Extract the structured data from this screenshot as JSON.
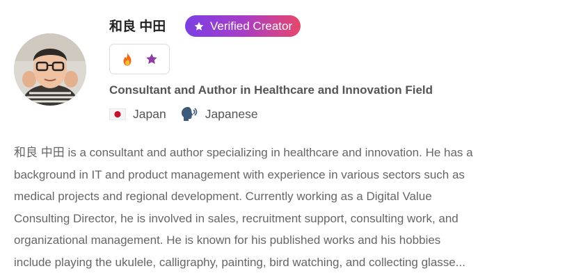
{
  "profile": {
    "name": "和良 中田",
    "badge_label": "Verified Creator",
    "badge_colors": [
      "#7b3fe4",
      "#a83dc8",
      "#e8476a"
    ],
    "badge_icon": "star-icon",
    "icons": [
      "fire-icon",
      "star-icon"
    ],
    "title": "Consultant and Author in Healthcare and Innovation Field",
    "country_flag": "japan-flag-icon",
    "country": "Japan",
    "language_icon": "speaking-head-icon",
    "language": "Japanese"
  },
  "bio": {
    "lines": [
      "和良 中田 is a consultant and author specializing in healthcare and innovation. He has a",
      "background in IT and product management with experience in various sectors such as",
      "medical projects and regional development. Currently working as a Digital Value",
      "Consulting Director, he is involved in sales, recruitment support, consulting work, and",
      "organizational management. He is known for his published works and his hobbies",
      "include playing the ukulele, calligraphy, painting, bird watching, and collecting glasse..."
    ]
  }
}
